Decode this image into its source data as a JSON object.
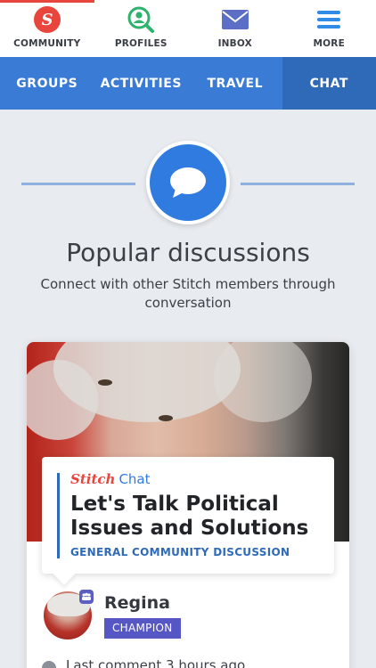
{
  "top_tabs": [
    {
      "label": "COMMUNITY",
      "icon": "stitch-logo-icon",
      "active": true
    },
    {
      "label": "PROFILES",
      "icon": "search-profile-icon",
      "active": false
    },
    {
      "label": "INBOX",
      "icon": "mail-icon",
      "active": false
    },
    {
      "label": "MORE",
      "icon": "menu-icon",
      "active": false
    }
  ],
  "section_nav": [
    {
      "label": "GROUPS",
      "active": false
    },
    {
      "label": "ACTIVITIES",
      "active": false
    },
    {
      "label": "TRAVEL",
      "active": false
    },
    {
      "label": "CHAT",
      "active": true
    }
  ],
  "hero": {
    "icon": "chat-bubble-icon",
    "title": "Popular discussions",
    "subtitle": "Connect with other Stitch members through conversation"
  },
  "discussion": {
    "brand": "Stitch",
    "brand_suffix": "Chat",
    "title": "Let's Talk Political Issues and Solutions",
    "category": "GENERAL COMMUNITY DISCUSSION",
    "author": {
      "name": "Regina",
      "rank": "CHAMPION"
    },
    "last_comment": "Last comment 3 hours ago"
  },
  "colors": {
    "accent_red": "#e8453c",
    "nav_blue": "#3a7bd5",
    "nav_blue_active": "#2f6ab9",
    "icon_green": "#2db36b",
    "icon_purple": "#5b6fc7",
    "icon_blue": "#2f8be6",
    "rank_purple": "#5656c5"
  }
}
